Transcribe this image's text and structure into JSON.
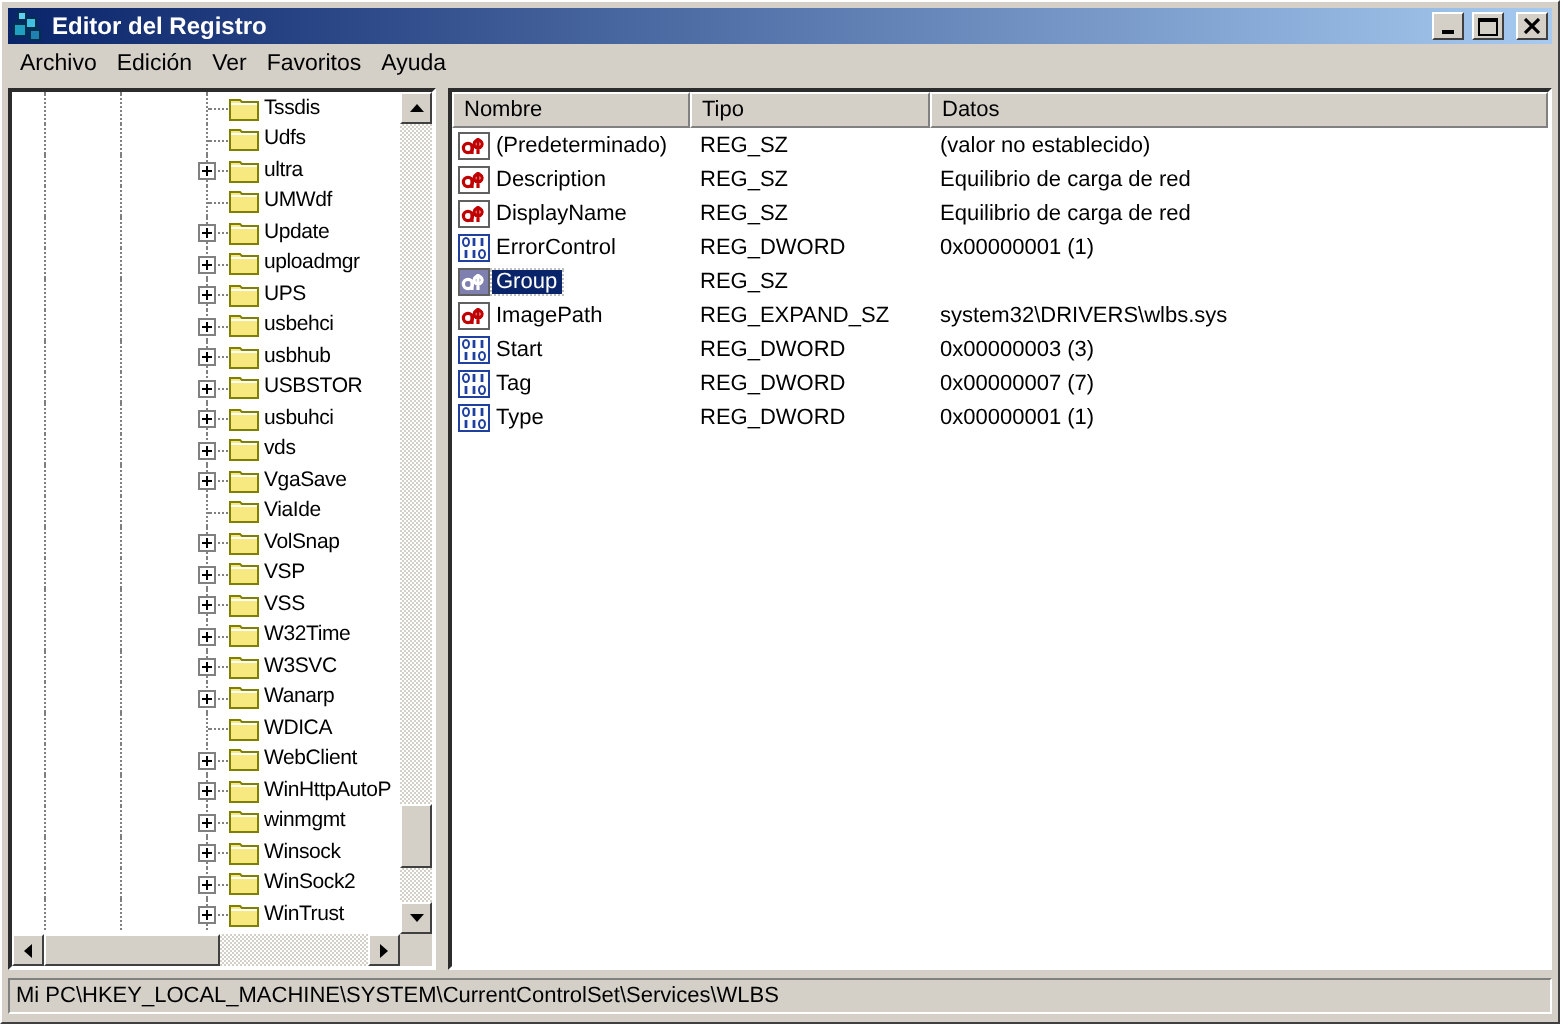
{
  "window": {
    "title": "Editor del Registro"
  },
  "menu": [
    "Archivo",
    "Edición",
    "Ver",
    "Favoritos",
    "Ayuda"
  ],
  "tree": {
    "items": [
      {
        "label": "Tssdis",
        "expandable": false
      },
      {
        "label": "Udfs",
        "expandable": false
      },
      {
        "label": "ultra",
        "expandable": true
      },
      {
        "label": "UMWdf",
        "expandable": false
      },
      {
        "label": "Update",
        "expandable": true
      },
      {
        "label": "uploadmgr",
        "expandable": true
      },
      {
        "label": "UPS",
        "expandable": true
      },
      {
        "label": "usbehci",
        "expandable": true
      },
      {
        "label": "usbhub",
        "expandable": true
      },
      {
        "label": "USBSTOR",
        "expandable": true
      },
      {
        "label": "usbuhci",
        "expandable": true
      },
      {
        "label": "vds",
        "expandable": true
      },
      {
        "label": "VgaSave",
        "expandable": true
      },
      {
        "label": "ViaIde",
        "expandable": false
      },
      {
        "label": "VolSnap",
        "expandable": true
      },
      {
        "label": "VSP",
        "expandable": true
      },
      {
        "label": "VSS",
        "expandable": true
      },
      {
        "label": "W32Time",
        "expandable": true
      },
      {
        "label": "W3SVC",
        "expandable": true
      },
      {
        "label": "Wanarp",
        "expandable": true
      },
      {
        "label": "WDICA",
        "expandable": false
      },
      {
        "label": "WebClient",
        "expandable": true
      },
      {
        "label": "WinHttpAutoP",
        "expandable": true
      },
      {
        "label": "winmgmt",
        "expandable": true
      },
      {
        "label": "Winsock",
        "expandable": true
      },
      {
        "label": "WinSock2",
        "expandable": true
      },
      {
        "label": "WinTrust",
        "expandable": true
      }
    ]
  },
  "table": {
    "columns": [
      "Nombre",
      "Tipo",
      "Datos"
    ],
    "rows": [
      {
        "kind": "string",
        "name": "(Predeterminado)",
        "type": "REG_SZ",
        "data": "(valor no establecido)",
        "selected": false
      },
      {
        "kind": "string",
        "name": "Description",
        "type": "REG_SZ",
        "data": "Equilibrio de carga de red",
        "selected": false
      },
      {
        "kind": "string",
        "name": "DisplayName",
        "type": "REG_SZ",
        "data": "Equilibrio de carga de red",
        "selected": false
      },
      {
        "kind": "binary",
        "name": "ErrorControl",
        "type": "REG_DWORD",
        "data": "0x00000001 (1)",
        "selected": false
      },
      {
        "kind": "string",
        "name": "Group",
        "type": "REG_SZ",
        "selected": true
      },
      {
        "kind": "string",
        "name": "ImagePath",
        "type": "REG_EXPAND_SZ",
        "data": "system32\\DRIVERS\\wlbs.sys",
        "selected": false
      },
      {
        "kind": "binary",
        "name": "Start",
        "type": "REG_DWORD",
        "data": "0x00000003 (3)",
        "selected": false
      },
      {
        "kind": "binary",
        "name": "Tag",
        "type": "REG_DWORD",
        "data": "0x00000007 (7)",
        "selected": false
      },
      {
        "kind": "binary",
        "name": "Type",
        "type": "REG_DWORD",
        "data": "0x00000001 (1)",
        "selected": false
      }
    ]
  },
  "status_bar": "Mi PC\\HKEY_LOCAL_MACHINE\\SYSTEM\\CurrentControlSet\\Services\\WLBS"
}
